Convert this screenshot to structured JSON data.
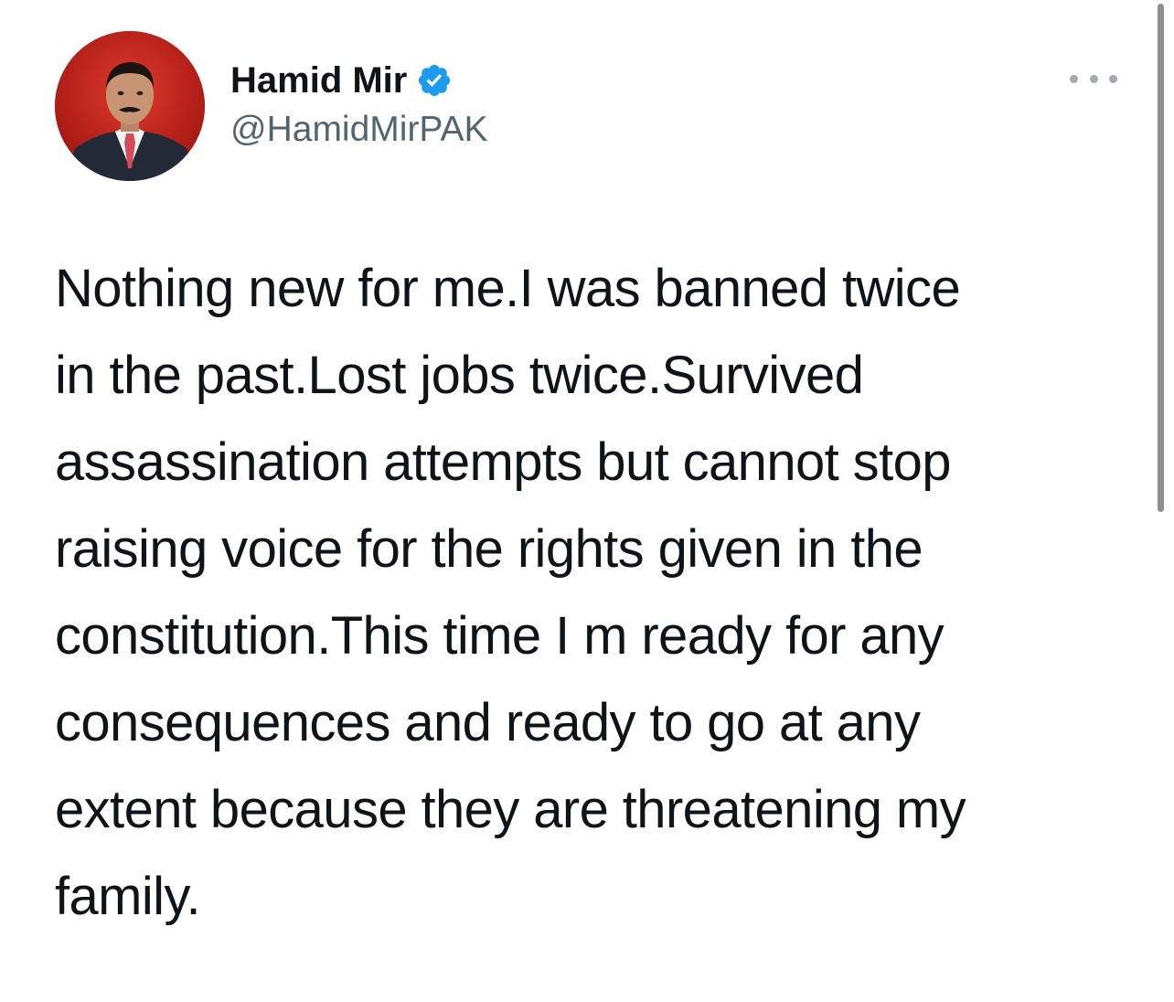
{
  "tweet": {
    "author": {
      "display_name": "Hamid Mir",
      "handle": "@HamidMirPAK",
      "verified": true,
      "avatar_icon": "profile-photo",
      "verified_icon": "verified-badge-icon"
    },
    "more_icon": "more-options-icon",
    "text_lines": [
      "Nothing new for me.I was banned twice",
      "in the past.Lost jobs twice.Survived",
      "assassination attempts but cannot stop",
      "raising voice for the rights given in the",
      "constitution.This time I m ready for any",
      "consequences and ready to go at any",
      "extent because they are threatening my",
      "family."
    ]
  },
  "colors": {
    "text": "#0f1419",
    "handle": "#536471",
    "verified_blue": "#1d9bf0",
    "avatar_background": "#c0201c",
    "more_dots": "#a2abb3",
    "scrollbar": "#8e8e8e"
  }
}
